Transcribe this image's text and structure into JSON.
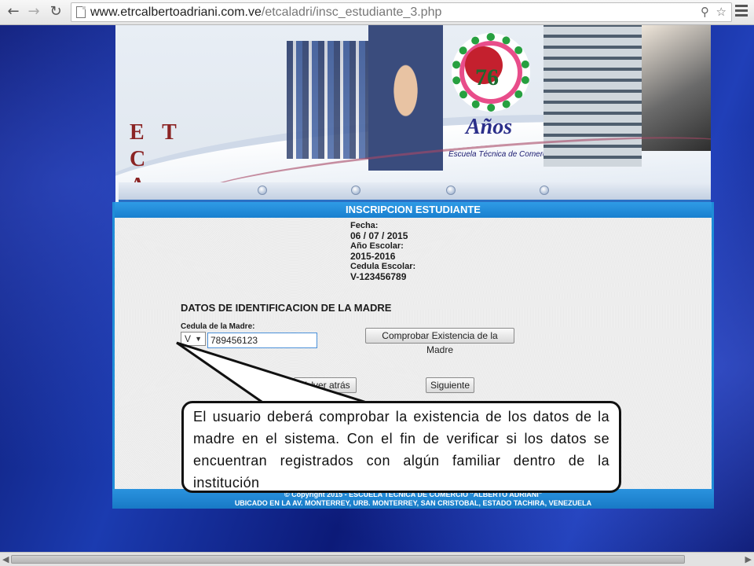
{
  "browser": {
    "url_domain": "www.etrcalbertoadriani.com.ve",
    "url_path": "/etcaladri/insc_estudiante_3.php"
  },
  "header": {
    "brand_line1": "E T C",
    "brand_line2": "A",
    "logo_number": "76",
    "logo_word": "Años",
    "logo_caption": "Escuela Técnica de Comercio"
  },
  "panel": {
    "title": "INSCRIPCION ESTUDIANTE",
    "fecha_label": "Fecha:",
    "fecha_value": "06 / 07 / 2015",
    "anio_label": "Año Escolar:",
    "anio_value": "2015-2016",
    "cedula_escolar_label": "Cedula Escolar:",
    "cedula_escolar_value": "V-123456789",
    "section_title": "DATOS DE IDENTIFICACION DE LA MADRE",
    "cedula_madre_label": "Cedula de la Madre:",
    "nacionalidad_value": "V",
    "cedula_madre_value": "789456123",
    "check_button": "Comprobar Existencia de la Madre",
    "back_button": "Volver atrás",
    "next_button": "Siguiente"
  },
  "footer": {
    "line1": "© Copyright 2015 - ESCUELA TECNICA DE COMERCIO \"ALBERTO ADRIANI\"",
    "line2": "UBICADO EN LA AV. MONTERREY, URB. MONTERREY, SAN CRISTOBAL, ESTADO TACHIRA, VENEZUELA"
  },
  "callout": {
    "text": "El usuario deberá comprobar la existencia de los datos de la madre en el sistema. Con el fin  de verificar si los datos se encuentran registrados con algún familiar dentro de la institución"
  },
  "colors": {
    "accent_blue": "#1f8ed8",
    "brand_red": "#8b2424",
    "desktop_blue": "#0b1a7a"
  },
  "icons": {
    "back": "arrow-left-icon",
    "forward": "arrow-right-icon",
    "reload": "reload-icon",
    "zoom": "zoom-icon",
    "star": "star-icon",
    "menu": "hamburger-menu-icon"
  }
}
